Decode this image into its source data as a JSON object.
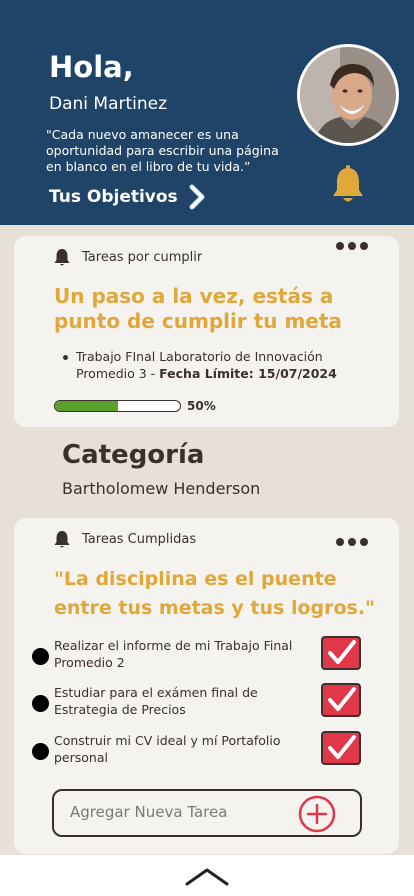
{
  "header": {
    "greeting": "Hola,",
    "user_name": "Dani Martinez",
    "quote": "\"Cada nuevo amanecer es una oportunidad para escribir una página en blanco en el libro de tu vida.”",
    "goals_link": "Tus Objetivos",
    "bg_color": "#1f4468",
    "bell_color": "#e0a73a"
  },
  "pending_card": {
    "label": "Tareas por cumplir",
    "headline": "Un paso a la vez, estás a punto de cumplir tu meta",
    "task_text": "Trabajo FInal Laboratorio de Innovación Promedio 3 - ",
    "task_deadline": "Fecha Límite: 15/07/2024",
    "progress_label": "50%",
    "progress_value": 0.5
  },
  "category": {
    "title": "Categoría",
    "subtitle": "Bartholomew Henderson"
  },
  "done_card": {
    "label": "Tareas Cumplidas",
    "headline": "\"La disciplina es el puente entre tus metas y tus logros.\"",
    "tasks": [
      {
        "text": "Realizar el informe de mi Trabajo Final Promedio 2",
        "checked": true
      },
      {
        "text": "Estudiar para el exámen final de Estrategia de Precios",
        "checked": true
      },
      {
        "text": "Construir mi CV ideal y mí Portafolio personal",
        "checked": true
      }
    ],
    "add_placeholder": "Agregar Nueva Tarea"
  },
  "colors": {
    "accent": "#e0a73a",
    "check": "#e0384a",
    "progress": "#5aa02c"
  }
}
